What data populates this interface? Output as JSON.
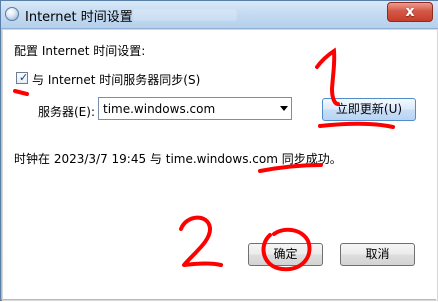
{
  "window": {
    "title": "Internet 时间设置",
    "close_symbol": "x"
  },
  "dialog": {
    "heading": "配置 Internet 时间设置:",
    "sync_checkbox": {
      "checked": true,
      "label": "与 Internet 时间服务器同步(S)"
    },
    "server": {
      "label": "服务器(E):",
      "value": "time.windows.com"
    },
    "update_button": "立即更新(U)",
    "status": "时钟在 2023/3/7 19:45 与 time.windows.com 同步成功。",
    "ok_button": "确定",
    "cancel_button": "取消"
  },
  "annotations": {
    "label_1": "1",
    "label_2": "2",
    "stroke_color": "#ff0000"
  }
}
